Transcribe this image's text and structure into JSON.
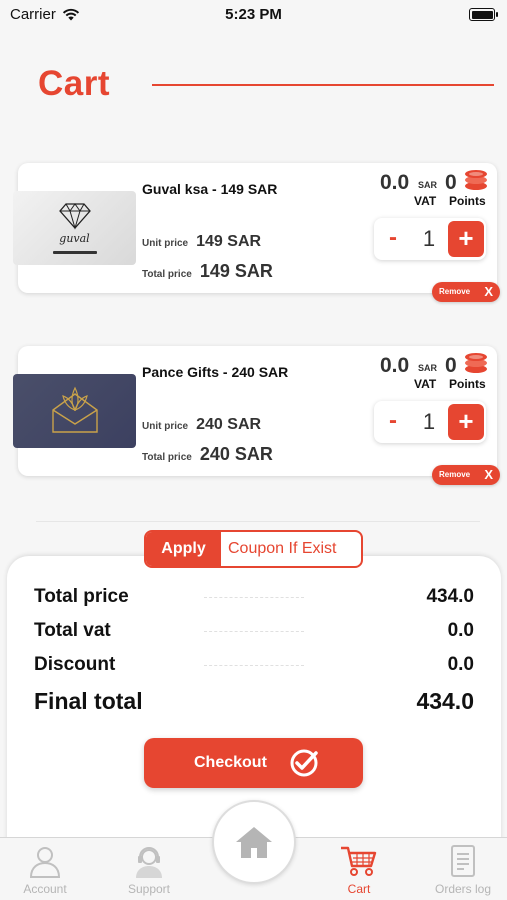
{
  "status_bar": {
    "carrier": "Carrier",
    "time": "5:23 PM"
  },
  "header": {
    "title": "Cart"
  },
  "items": [
    {
      "name": "Guval ksa - 149 SAR",
      "unit_price_label": "Unit price",
      "unit_price": "149 SAR",
      "total_price_label": "Total price",
      "total_price": "149 SAR",
      "vat_value": "0.0",
      "vat_currency": "SAR",
      "vat_label": "VAT",
      "points_value": "0",
      "points_label": "Points",
      "quantity": "1",
      "minus_label": "-",
      "plus_label": "+",
      "remove_label": "Remove",
      "remove_x": "X",
      "image_brand": "guval"
    },
    {
      "name": "Pance Gifts - 240 SAR",
      "unit_price_label": "Unit price",
      "unit_price": "240 SAR",
      "total_price_label": "Total price",
      "total_price": "240 SAR",
      "vat_value": "0.0",
      "vat_currency": "SAR",
      "vat_label": "VAT",
      "points_value": "0",
      "points_label": "Points",
      "quantity": "1",
      "minus_label": "-",
      "plus_label": "+",
      "remove_label": "Remove",
      "remove_x": "X"
    }
  ],
  "coupon": {
    "apply_label": "Apply",
    "placeholder": "Coupon If Exist"
  },
  "summary": {
    "total_price_label": "Total price",
    "total_price": "434.0",
    "total_vat_label": "Total vat",
    "total_vat": "0.0",
    "discount_label": "Discount",
    "discount": "0.0",
    "final_total_label": "Final total",
    "final_total": "434.0",
    "checkout_label": "Checkout"
  },
  "tabs": [
    {
      "label": "Account",
      "icon": "person-icon",
      "active": false
    },
    {
      "label": "Support",
      "icon": "headset-icon",
      "active": false
    },
    {
      "label": "Cart",
      "icon": "cart-icon",
      "active": true
    },
    {
      "label": "Orders log",
      "icon": "document-icon",
      "active": false
    }
  ],
  "colors": {
    "accent": "#e64631",
    "background": "#f6f6f6",
    "inactive_tab": "#b5b5b5"
  }
}
